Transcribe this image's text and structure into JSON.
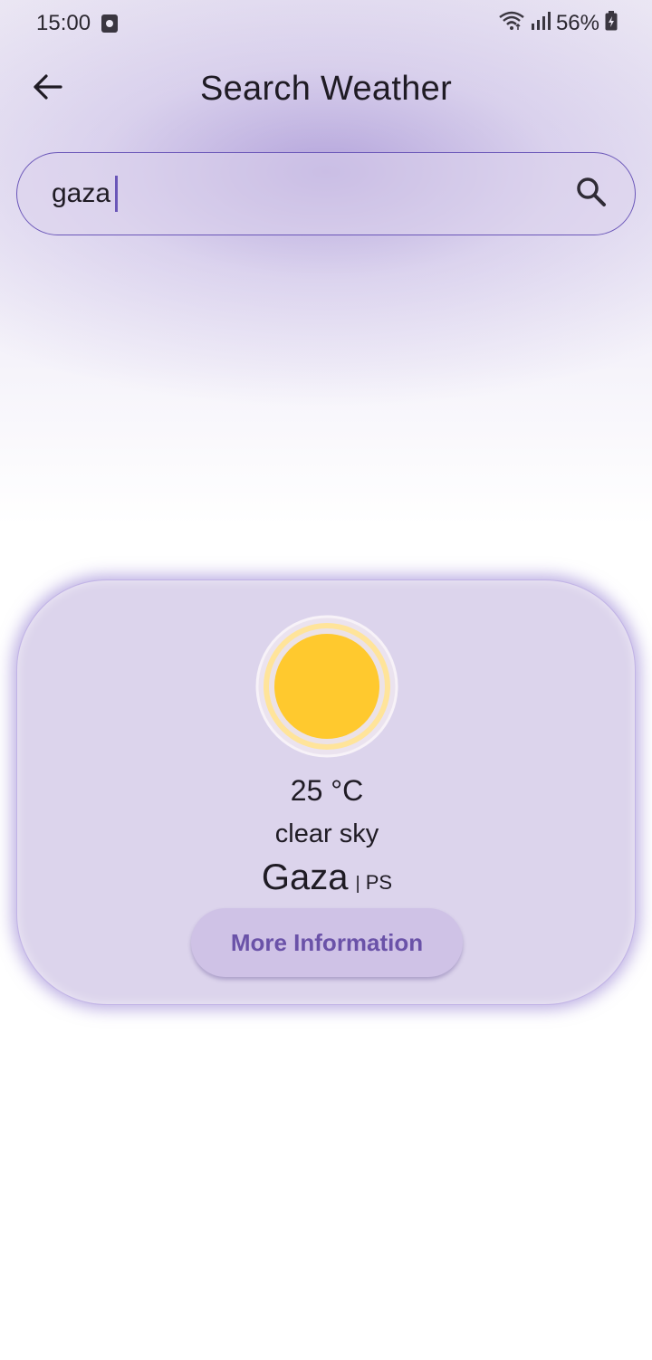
{
  "status_bar": {
    "time": "15:00",
    "battery": "56%",
    "icons": [
      "notification-icon",
      "wifi-icon",
      "signal-icon",
      "battery-icon"
    ]
  },
  "app_bar": {
    "title": "Search Weather",
    "back_icon": "arrow-back-icon"
  },
  "search": {
    "value": "gaza",
    "icon": "search-icon"
  },
  "weather": {
    "icon": "sun-icon",
    "temperature": "25 °C",
    "condition": "clear sky",
    "city": "Gaza",
    "separator": "|",
    "country": "PS",
    "button_label": "More Information"
  },
  "colors": {
    "accent": "#6a56b8",
    "card": "#dcd4ec",
    "sun": "#ffc92e",
    "button_text": "#6a52a8"
  }
}
